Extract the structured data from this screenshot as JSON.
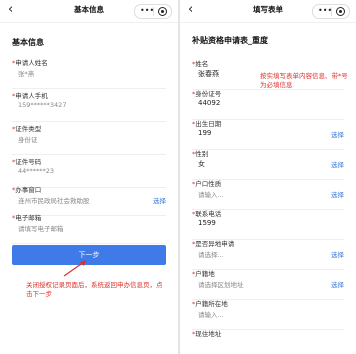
{
  "left": {
    "nav_title": "基本信息",
    "section_title": "基本信息",
    "fields": [
      {
        "label": "申请人姓名",
        "value": "张*燕"
      },
      {
        "label": "申请人手机",
        "value": "159******3427"
      },
      {
        "label": "证件类型",
        "value": "身份证"
      },
      {
        "label": "证件号码",
        "value": "44******23"
      },
      {
        "label": "办事窗口",
        "value": "连州市民政局社会救助股",
        "choose": "选择"
      },
      {
        "label": "电子邮箱",
        "value": "请填写电子邮箱"
      }
    ],
    "next_button": "下一步",
    "annotation": "关闭授权记录页面后，系统返回申办信息页，点击下一步"
  },
  "right": {
    "nav_title": "填写表单",
    "section_title": "补贴资格申请表_重度",
    "annotation": "按实填写表单内容信息、带*号为必填信息",
    "fields": [
      {
        "label": "姓名",
        "value": "张春燕"
      },
      {
        "label": "身份证号",
        "value": "44092"
      },
      {
        "label": "出生日期",
        "value": "199",
        "choose": "选择"
      },
      {
        "label": "性别",
        "value": "女",
        "choose": "选择"
      },
      {
        "label": "户口性质",
        "value": "请输入...",
        "choose": "选择"
      },
      {
        "label": "联系电话",
        "value": "1599"
      },
      {
        "label": "是否异地申请",
        "value": "请选择...",
        "choose": "选择"
      },
      {
        "label": "户籍地",
        "value": "请选择区划地址",
        "choose": "选择"
      },
      {
        "label": "户籍所在地",
        "value": "请输入..."
      },
      {
        "label": "现住地址",
        "value": ""
      }
    ]
  },
  "icons": {
    "back": "chevron-left-icon",
    "more": "more-dots-icon",
    "close": "mini-program-close-icon"
  },
  "colors": {
    "accent": "#3f7be8",
    "annotation": "#e0302a",
    "link": "#3a78d8"
  }
}
